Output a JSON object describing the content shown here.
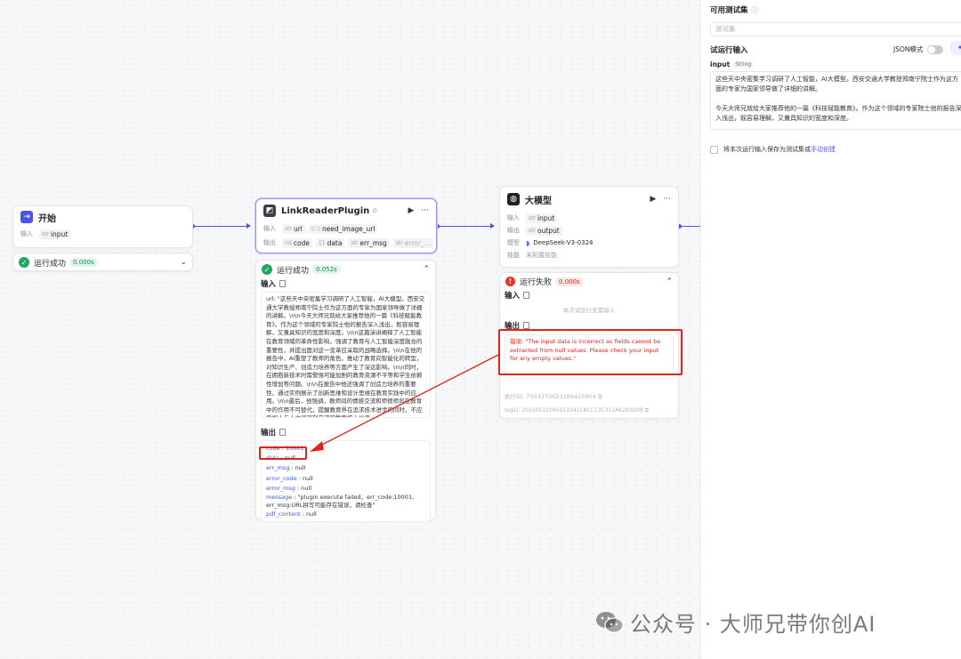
{
  "start": {
    "title": "开始",
    "input_label": "输入",
    "params": [
      "input"
    ],
    "status": "运行成功",
    "time": "0.000s"
  },
  "plugin": {
    "title": "LinkReaderPlugin",
    "input_label": "输入",
    "inputs": [
      "url",
      "need_image_url"
    ],
    "output_label": "输出",
    "outputs": [
      "code",
      "data",
      "err_msg",
      "error_..."
    ],
    "status": "运行成功",
    "time": "0.052s",
    "in_section": "输入",
    "in_text": "url: \"这些天中央密集学习调研了人工智能，AI大模型。西安交通大学教授郑南宁院士作为这方面的专家为国家领导做了详细的讲解。\\n\\n今天大师兄就给大家推荐他的一篇《科技赋能教育》。作为这个领域的专家院士他的报告深入浅出，既容易理解，又兼具知识的宽度和深度。\\n\\n这篇演讲阐释了人工智能在教育领域的革命性影响，强调了教育与人工智能深度融合的重要性，并提出面对这一变革应采取的战略选择。\\n\\n在他的报告中，AI重塑了教师的角色，推动了教育向智能化的转型，对知识生产、创造力培养等方面产生了深远影响。\\n\\n同时，在拥抱新技术时需警惕可能加剧的教育资源不平等和学生依赖性增加等问题。\\n\\n在报告中他还强调了创造力培养的重要性，通过实例展示了创新思维和设计思维在教育实践中的应用。\\n\\n最后，他强调，教师间的情感交流和师德师风在教育中的作用不可替代，提醒教育界在追求技术进步的同时，不应忽视人与人之间深刻交流的教育核心价值。",
    "out_section": "输出",
    "out_rows": [
      {
        "k": "code",
        "v": "10001"
      },
      {
        "k": "data",
        "v": "null"
      },
      {
        "k": "err_msg",
        "v": "null"
      },
      {
        "k": "error_code",
        "v": "null"
      },
      {
        "k": "error_msg",
        "v": "null"
      },
      {
        "k": "message",
        "v": "\"plugin execute failed，err_code:10001, err_msg:URL拼写可能存在错误，请检查\""
      },
      {
        "k": "pdf_content",
        "v": "null"
      }
    ]
  },
  "llm": {
    "title": "大模型",
    "input_label": "输入",
    "inputs": [
      "input"
    ],
    "output_label": "输出",
    "outputs": [
      "output"
    ],
    "model_label": "模型",
    "model": "DeepSeek-V3-0324",
    "skill_label": "技能",
    "skill": "未配置技能",
    "status": "运行失败",
    "time": "0.000s",
    "in_section": "输入",
    "no_input": "本次试运行无需输入",
    "out_section": "输出",
    "error_text": "错误: \"The input data is incorrect as fields cannot be extracted from null values. Please check your input for any empty values.\"",
    "exec_id": "执行ID: 7503370623289425954",
    "log_id": "logID: 20250512095013341C8CC13C311A6283D08"
  },
  "panel": {
    "testset_label": "可用测试集",
    "testset_placeholder": "测试集",
    "trial_label": "试运行输入",
    "json_mode": "JSON模式",
    "input_name": "input",
    "input_type": "String",
    "input_text_1": "这些天中央密集学习调研了人工智能，AI大模型。西安交通大学教授郑南宁院士作为这方面的专家为国家领导做了详细的讲解。",
    "input_text_2": "今天大师兄就给大家推荐他的一篇《科技赋能教育》。作为这个领域的专家院士他的报告深入浅出，既容易理解，又兼具知识的宽度和深度。",
    "save_text": "将本次运行输入保存为测试集或",
    "save_link": "手动创建"
  },
  "watermark": "公众号 · 大师兄带你创AI",
  "colors": {
    "accent": "#4d53e8",
    "success": "#21a663",
    "error": "#e5322d",
    "annotation": "#e0231c"
  }
}
